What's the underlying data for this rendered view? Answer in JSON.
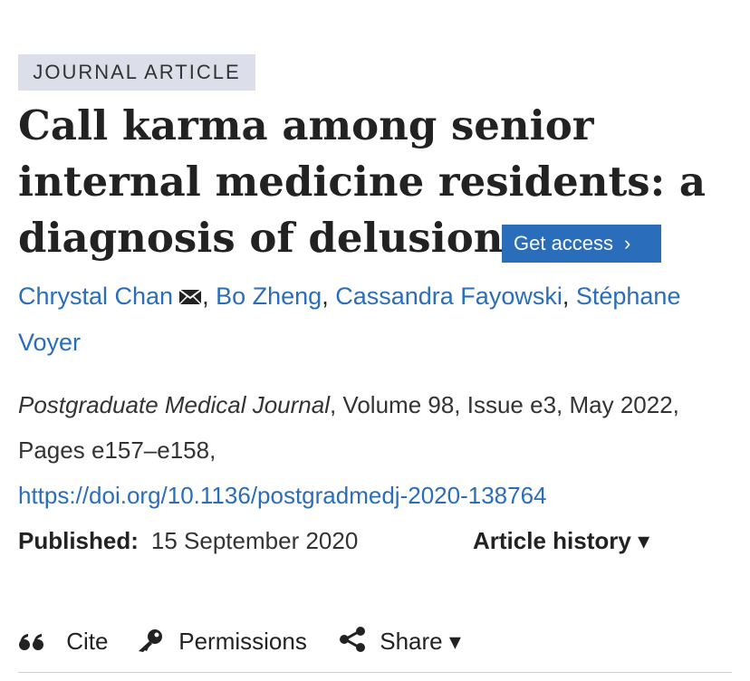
{
  "badge": "JOURNAL ARTICLE",
  "title": "Call karma among senior internal medicine residents: a diagnosis of delusion",
  "get_access": {
    "label": "Get access",
    "chevron": "›"
  },
  "authors": [
    {
      "name": "Chrystal Chan",
      "separator": ","
    },
    {
      "name": "Bo Zheng",
      "separator": ","
    },
    {
      "name": "Cassandra Fayowski",
      "separator": ","
    },
    {
      "name": "Stéphane Voyer",
      "separator": ""
    }
  ],
  "citation": {
    "journal": "Postgraduate Medical Journal",
    "details": ", Volume 98, Issue e3, May 2022, Pages e157–e158,",
    "doi": "https://doi.org/10.1136/postgradmedj-2020-138764"
  },
  "published": {
    "label": "Published:",
    "date": "15 September 2020",
    "history_label": "Article history",
    "history_caret": "▾"
  },
  "toolbar": {
    "cite": "Cite",
    "cite_glyph": "66",
    "permissions": "Permissions",
    "share": "Share",
    "share_caret": "▾"
  },
  "colors": {
    "link": "#2a6ebb",
    "badge_bg": "#dcdfea",
    "button_bg": "#2a6ebb"
  },
  "icons": [
    "mail-icon",
    "quote-icon",
    "key-icon",
    "share-icon",
    "chevron-right-icon",
    "caret-down-icon"
  ]
}
